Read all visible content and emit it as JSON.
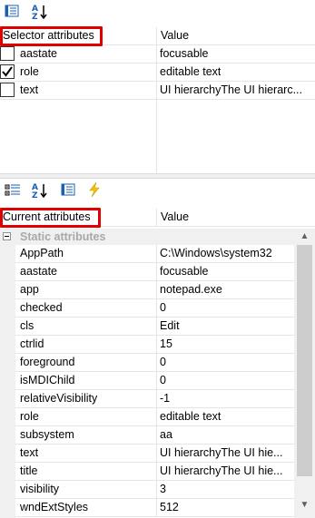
{
  "selector_pane": {
    "header": {
      "col1": "Selector attributes",
      "col2": "Value"
    },
    "rows": [
      {
        "name": "aastate",
        "value": "focusable",
        "checked": false
      },
      {
        "name": "role",
        "value": "editable text",
        "checked": true
      },
      {
        "name": "text",
        "value": "UI hierarchyThe UI hierarc...",
        "checked": false
      }
    ]
  },
  "current_pane": {
    "header": {
      "col1": "Current attributes",
      "col2": "Value"
    },
    "group_label": "Static attributes",
    "rows": [
      {
        "name": "AppPath",
        "value": "C:\\Windows\\system32"
      },
      {
        "name": "aastate",
        "value": "focusable"
      },
      {
        "name": "app",
        "value": "notepad.exe"
      },
      {
        "name": "checked",
        "value": "0"
      },
      {
        "name": "cls",
        "value": "Edit"
      },
      {
        "name": "ctrlid",
        "value": "15"
      },
      {
        "name": "foreground",
        "value": "0"
      },
      {
        "name": "isMDIChild",
        "value": "0"
      },
      {
        "name": "relativeVisibility",
        "value": "-1"
      },
      {
        "name": "role",
        "value": "editable text"
      },
      {
        "name": "subsystem",
        "value": "aa"
      },
      {
        "name": "text",
        "value": "UI hierarchyThe UI hie..."
      },
      {
        "name": "title",
        "value": "UI hierarchyThe UI hie..."
      },
      {
        "name": "visibility",
        "value": "3"
      },
      {
        "name": "wndExtStyles",
        "value": "512"
      }
    ]
  },
  "colors": {
    "highlight_box": "#e00000",
    "group_background": "#f0f0f0",
    "icon_blue": "#1a5fb4",
    "lightning": "#f5c400"
  }
}
